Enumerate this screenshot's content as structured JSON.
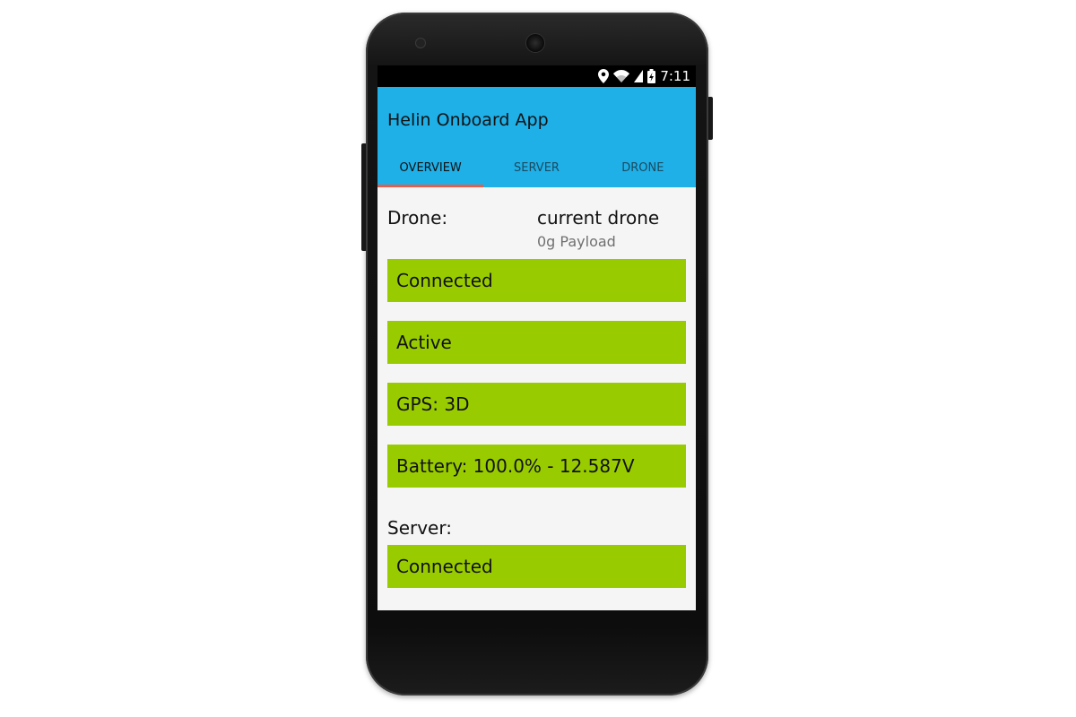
{
  "status_bar": {
    "time": "7:11",
    "icons": [
      "location-icon",
      "wifi-icon",
      "signal-icon",
      "battery-charging-icon"
    ]
  },
  "app": {
    "title": "Helin Onboard App",
    "accent_color": "#1fb0e8",
    "tab_indicator_color": "#e85d4a",
    "ok_color": "#99cc00"
  },
  "tabs": [
    {
      "label": "OVERVIEW",
      "active": true
    },
    {
      "label": "SERVER",
      "active": false
    },
    {
      "label": "DRONE",
      "active": false
    }
  ],
  "overview": {
    "drone_label": "Drone:",
    "drone_name": "current drone",
    "drone_payload": "0g Payload",
    "drone_status": [
      "Connected",
      "Active",
      "GPS: 3D",
      "Battery: 100.0% - 12.587V"
    ],
    "server_label": "Server:",
    "server_status": "Connected"
  }
}
